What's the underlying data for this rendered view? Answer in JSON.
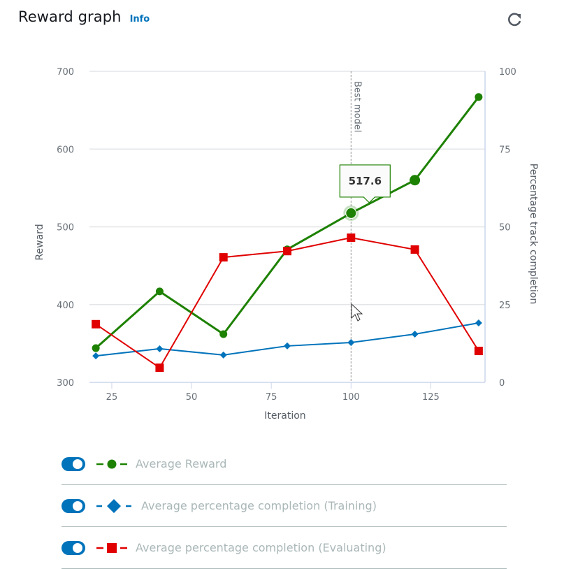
{
  "header": {
    "title": "Reward graph",
    "info_label": "Info",
    "refresh_icon": "refresh-icon"
  },
  "colors": {
    "reward": "#1d8102",
    "training": "#0073bb",
    "evaluating": "#e00000",
    "toggle_on": "#0073bb",
    "info_link": "#0073bb"
  },
  "tooltip": {
    "value": "517.6",
    "iteration": 100
  },
  "best_model": {
    "label": "Best model",
    "iteration": 100
  },
  "chart_data": {
    "type": "line",
    "title": "Reward graph",
    "xlabel": "Iteration",
    "ylabel": "Reward",
    "y2label": "Percentage track completion",
    "x": [
      20,
      40,
      60,
      80,
      100,
      120,
      140
    ],
    "xlim": [
      18,
      142
    ],
    "xticks": [
      25,
      50,
      75,
      100,
      125
    ],
    "ylim": [
      300,
      700
    ],
    "yticks": [
      300,
      400,
      500,
      600,
      700
    ],
    "y2lim": [
      0,
      100
    ],
    "y2ticks": [
      0,
      25,
      50,
      75,
      100
    ],
    "grid": true,
    "legend_position": "bottom",
    "series": [
      {
        "name": "Average Reward",
        "axis": "left",
        "marker": "circle",
        "color": "#1d8102",
        "values": [
          344,
          417,
          362,
          471,
          517.6,
          560,
          667
        ]
      },
      {
        "name": "Average percentage completion (Training)",
        "axis": "right",
        "marker": "diamond",
        "color": "#0073bb",
        "values": [
          8.5,
          10.8,
          8.8,
          11.7,
          12.8,
          15.5,
          19.1
        ]
      },
      {
        "name": "Average percentage completion (Evaluating)",
        "axis": "right",
        "marker": "square",
        "color": "#e00000",
        "values": [
          18.7,
          4.7,
          40.2,
          42.2,
          46.5,
          42.7,
          10.1
        ]
      }
    ]
  },
  "legend": [
    {
      "label": "Average Reward",
      "enabled": true,
      "marker": "circle",
      "color": "#1d8102"
    },
    {
      "label": "Average percentage completion (Training)",
      "enabled": true,
      "marker": "diamond",
      "color": "#0073bb"
    },
    {
      "label": "Average percentage completion (Evaluating)",
      "enabled": true,
      "marker": "square",
      "color": "#e00000"
    }
  ]
}
